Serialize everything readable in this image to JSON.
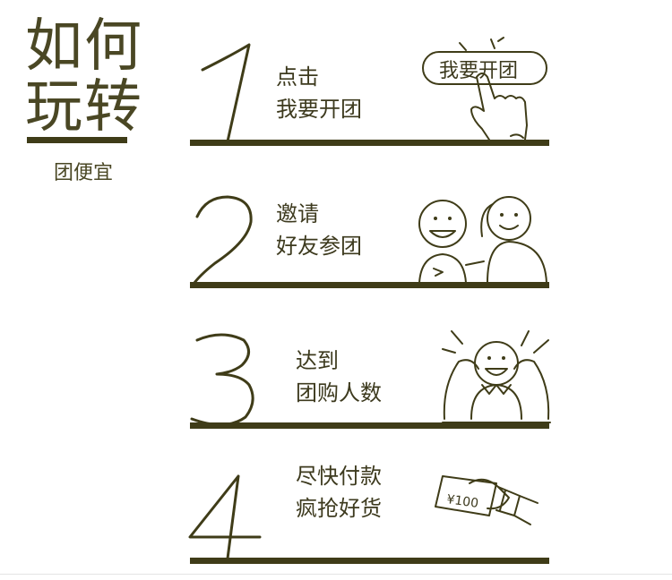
{
  "header": {
    "title_line1": "如何",
    "title_line2": "玩转",
    "subtitle": "团便宜"
  },
  "steps": [
    {
      "number": "1",
      "line1": "点击",
      "line2": "我要开团",
      "button_label": "我要开团",
      "icon": "tap-button-hand-icon"
    },
    {
      "number": "2",
      "line1": "邀请",
      "line2": "好友参团",
      "icon": "two-friends-icon"
    },
    {
      "number": "3",
      "line1": "达到",
      "line2": "团购人数",
      "icon": "celebrating-group-icon"
    },
    {
      "number": "4",
      "line1": "尽快付款",
      "line2": "疯抢好货",
      "money_label": "¥100",
      "icon": "hand-paying-money-icon"
    }
  ],
  "colors": {
    "primary": "#3f3c18",
    "text": "#3d3a1e"
  }
}
